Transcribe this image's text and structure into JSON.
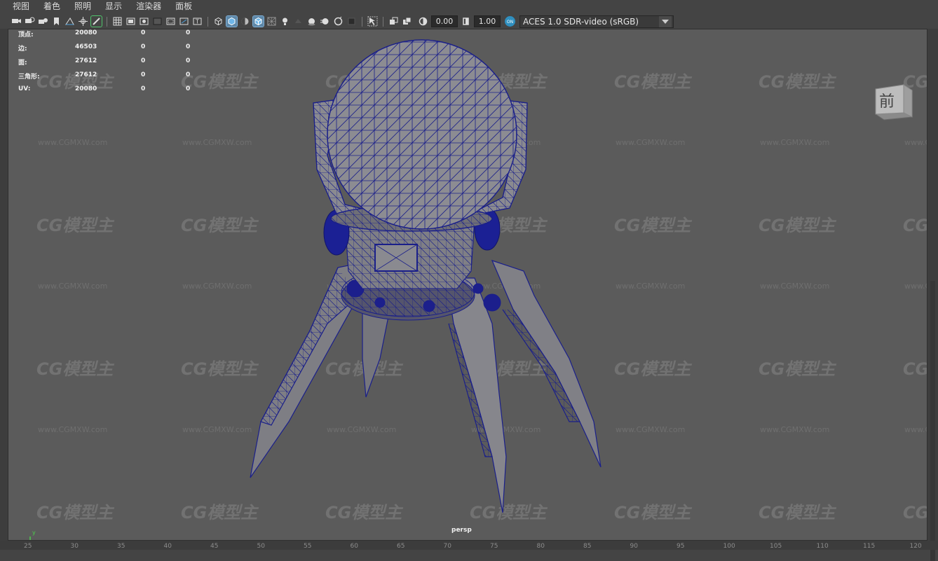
{
  "menu": [
    "视图",
    "着色",
    "照明",
    "显示",
    "渲染器",
    "面板"
  ],
  "toolbar": {
    "exposure_value": "0.00",
    "gamma_value": "1.00",
    "color_management": "ACES 1.0 SDR-video (sRGB)",
    "icons": [
      "camera-select-icon",
      "camera-attributes-icon",
      "camera-lock-icon",
      "bookmark-icon",
      "image-plane-icon",
      "2d-pan-zoom-icon",
      "grease-pencil-icon",
      "grid-icon",
      "film-gate-icon",
      "resolution-gate-icon",
      "gate-mask-icon",
      "field-chart-icon",
      "safe-action-icon",
      "safe-title-icon",
      "wireframe-icon",
      "smooth-shade-icon",
      "default-material-icon",
      "wireframe-on-shaded-icon",
      "xray-icon",
      "use-default-light-icon",
      "shadows-icon",
      "screen-space-ao-icon",
      "motion-blur-icon",
      "multisample-aa-icon",
      "depth-of-field-icon",
      "isolate-select-icon",
      "xray-joints-icon",
      "xray-components-icon",
      "exposure-icon",
      "gamma-icon",
      "color-management-icon"
    ]
  },
  "hud": {
    "rows": [
      {
        "label": "顶点:",
        "a": "20080",
        "b": "0",
        "c": "0"
      },
      {
        "label": "边:",
        "a": "46503",
        "b": "0",
        "c": "0"
      },
      {
        "label": "面:",
        "a": "27612",
        "b": "0",
        "c": "0"
      },
      {
        "label": "三角形:",
        "a": "27612",
        "b": "0",
        "c": "0"
      },
      {
        "label": "UV:",
        "a": "20080",
        "b": "0",
        "c": "0"
      }
    ]
  },
  "viewport": {
    "camera_label": "persp",
    "view_cube_label": "前",
    "axis": {
      "y": "y",
      "x": "x",
      "z": "z"
    }
  },
  "watermark": {
    "brand": "CG模型主",
    "url": "www.CGMXW.com"
  },
  "ruler": [
    "25",
    "30",
    "35",
    "40",
    "45",
    "50",
    "55",
    "60",
    "65",
    "70",
    "75",
    "80",
    "85",
    "90",
    "95",
    "100",
    "105",
    "110",
    "115",
    "120"
  ],
  "colors": {
    "viewport_bg": "#5b5b5b",
    "ui_bg": "#444444",
    "wire": "#1a1f8a",
    "mesh": "#7d7d83",
    "active_icon": "#5d87a8"
  }
}
